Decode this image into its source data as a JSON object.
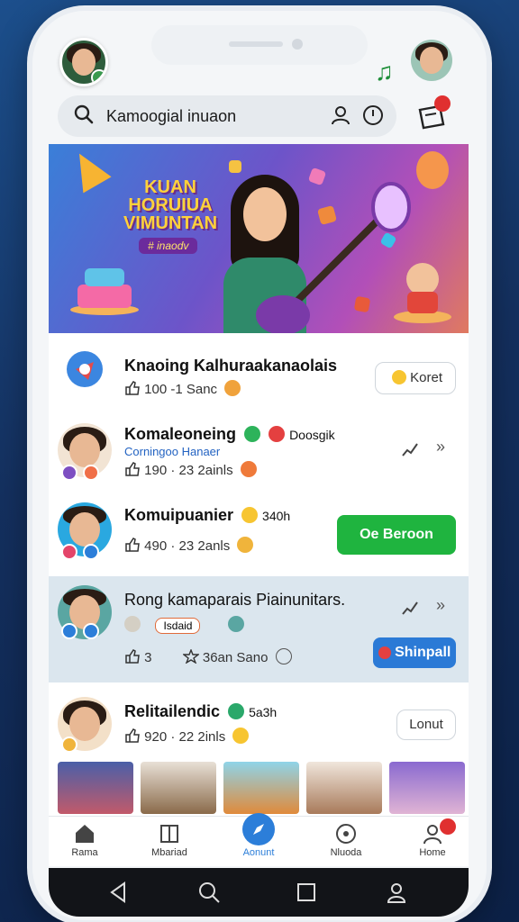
{
  "search": {
    "text": "Kamoogial inuaon"
  },
  "gift_badge_count": "",
  "banner": {
    "title_lines": [
      "KUAN",
      "HORUIUA",
      "VIMUNTAN"
    ],
    "tag": "# inaodv"
  },
  "feed": [
    {
      "title": "Knaoing Kalhuraakanaolais",
      "sub": "",
      "stats": "100 -1 Sanc",
      "button": "Koret",
      "button_style": "outline",
      "avatar_color": "#dfe6f0"
    },
    {
      "title": "Komaleoneing",
      "title_extra": "Doosgik",
      "sub": "Corningoo Hanaer",
      "stats": "190 · 23 2ainls",
      "button": "",
      "button_style": "icons",
      "avatar_color": "#f2e4d4"
    },
    {
      "title": "Komuipuanier",
      "title_extra": "340h",
      "sub": "",
      "stats": "490 · 23 2anls",
      "button": "Oe Beroon",
      "button_style": "green",
      "avatar_color": "#2aa8e0"
    },
    {
      "title": "Rong kamaparais Piainunitars.",
      "chip": "Isdaid",
      "sub": "",
      "stats_a": "3",
      "stats_b": "36an Sano",
      "button": "Shinpall",
      "button_style": "blue",
      "avatar_color": "#5aa6a2"
    },
    {
      "title": "Relitailendic",
      "title_extra": "5a3h",
      "sub": "",
      "stats": "920 · 22 2inls",
      "button": "Lonut",
      "button_style": "outline",
      "avatar_color": "#f3e0c8"
    }
  ],
  "tabs": [
    {
      "label": "Rama",
      "icon": "home-icon"
    },
    {
      "label": "Mbariad",
      "icon": "box-icon"
    },
    {
      "label": "Aonunt",
      "icon": "compass-icon",
      "active": true
    },
    {
      "label": "Nluoda",
      "icon": "music-disc-icon"
    },
    {
      "label": "Home",
      "icon": "profile-icon"
    }
  ],
  "colors": {
    "accent": "#2c7ed9",
    "green": "#1fb43f",
    "badge": "#e03030"
  }
}
